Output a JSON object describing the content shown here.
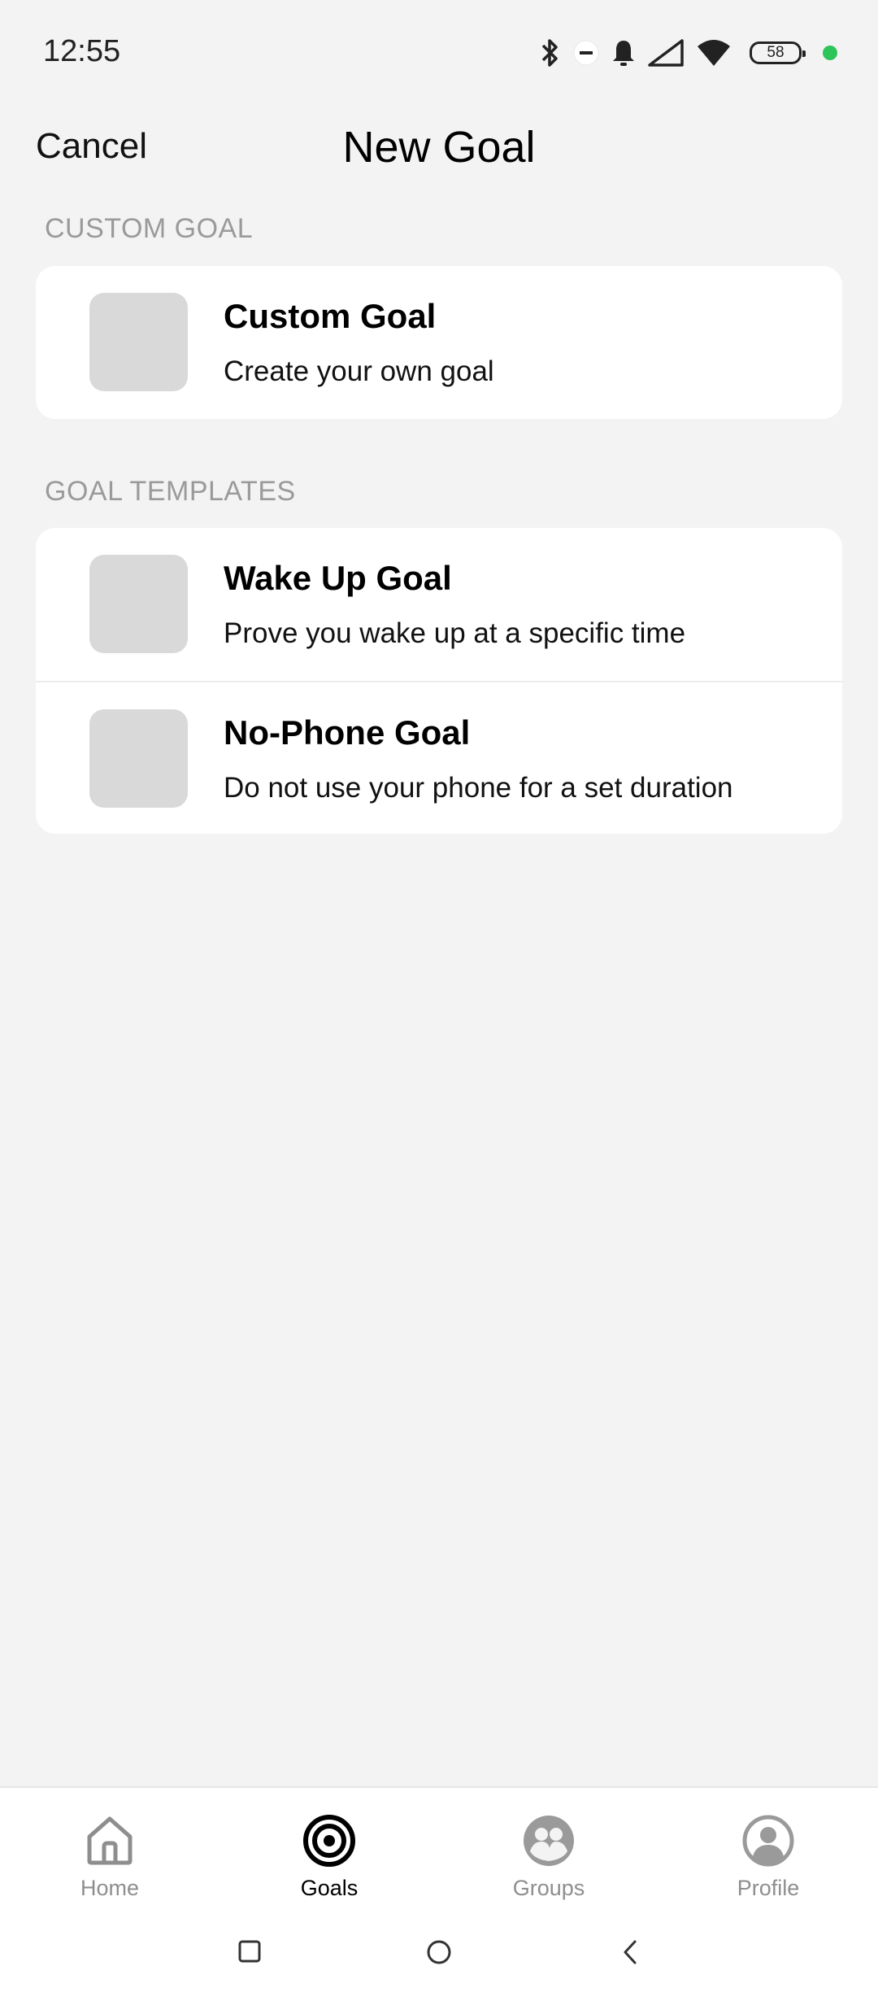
{
  "status_bar": {
    "time": "12:55",
    "battery_level": "58",
    "icons": [
      "bluetooth-icon",
      "dnd-icon",
      "bell-icon",
      "signal-icon",
      "wifi-icon",
      "battery-icon"
    ],
    "dot_color": "#2fc45a"
  },
  "header": {
    "cancel_label": "Cancel",
    "title": "New Goal"
  },
  "custom_section": {
    "label": "CUSTOM GOAL",
    "items": [
      {
        "title": "Custom Goal",
        "subtitle": "Create your own goal"
      }
    ]
  },
  "templates_section": {
    "label": "GOAL TEMPLATES",
    "items": [
      {
        "title": "Wake Up Goal",
        "subtitle": "Prove you wake up at a specific time"
      },
      {
        "title": "No-Phone Goal",
        "subtitle": "Do not use your phone for a set duration"
      }
    ]
  },
  "bottom_nav": {
    "active": "Goals",
    "items": [
      {
        "label": "Home",
        "icon": "home-icon"
      },
      {
        "label": "Goals",
        "icon": "target-icon"
      },
      {
        "label": "Groups",
        "icon": "groups-icon"
      },
      {
        "label": "Profile",
        "icon": "profile-icon"
      }
    ]
  },
  "colors": {
    "background": "#f3f3f3",
    "card": "#ffffff",
    "placeholder_thumb": "#d9d9d9",
    "section_label": "#9a9a9a",
    "inactive_nav": "#8e8e8e"
  }
}
